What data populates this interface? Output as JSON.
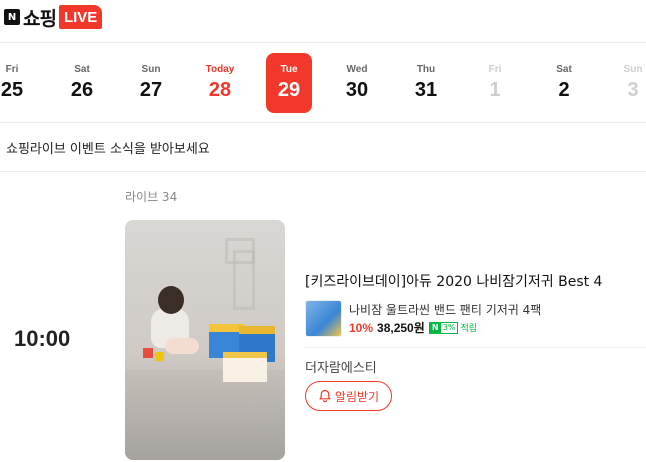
{
  "header": {
    "logo_n": "N",
    "logo_text": "쇼핑",
    "logo_live": "LIVE"
  },
  "dates": [
    {
      "dow": "Fri",
      "day": "25",
      "state": "past"
    },
    {
      "dow": "Sat",
      "day": "26",
      "state": "past"
    },
    {
      "dow": "Sun",
      "day": "27",
      "state": "past"
    },
    {
      "dow": "Today",
      "day": "28",
      "state": "today"
    },
    {
      "dow": "Tue",
      "day": "29",
      "state": "selected"
    },
    {
      "dow": "Wed",
      "day": "30",
      "state": "upcoming"
    },
    {
      "dow": "Thu",
      "day": "31",
      "state": "upcoming"
    },
    {
      "dow": "Fri",
      "day": "1",
      "state": "future"
    },
    {
      "dow": "Sat",
      "day": "2",
      "state": "upcoming"
    },
    {
      "dow": "Sun",
      "day": "3",
      "state": "future"
    }
  ],
  "notice": "쇼핑라이브 이벤트 소식을 받아보세요",
  "live": {
    "count_label": "라이브 34",
    "time": "10:00",
    "title": "[키즈라이브데이]아듀 2020 나비잠기저귀 Best 4",
    "product": {
      "name": "나비잠 울트라씬 밴드 팬티 기저귀 4팩",
      "discount": "10%",
      "price": "38,250원",
      "npay_badge": "N",
      "npay_percent": "3%",
      "reward": "적립"
    },
    "seller": "더자람에스티",
    "alarm_label": "알림받기"
  },
  "colors": {
    "accent": "#f2382a",
    "npay_green": "#00b843"
  }
}
